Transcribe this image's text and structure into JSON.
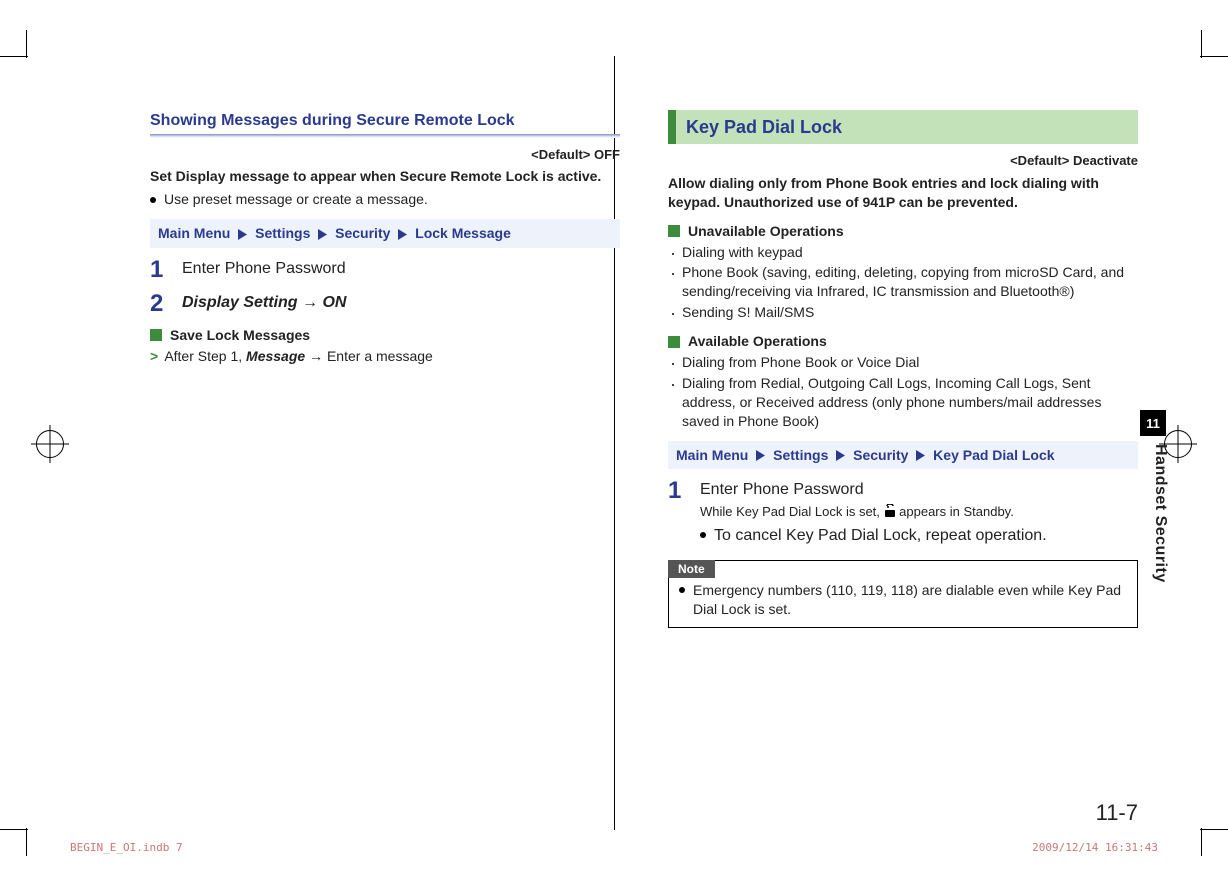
{
  "left": {
    "heading": "Showing Messages during Secure Remote Lock",
    "default": "<Default> OFF",
    "intro": "Set Display message to appear when Secure Remote Lock is active.",
    "intro_bullet": "Use preset message or create a message.",
    "crumb": [
      "Main Menu",
      "Settings",
      "Security",
      "Lock Message"
    ],
    "step1": "Enter Phone Password",
    "step2_a": "Display Setting",
    "step2_b": "ON",
    "sub_header": "Save Lock Messages",
    "sub_line_pre": "After Step 1,",
    "sub_line_mid": "Message",
    "sub_line_post": "Enter a message"
  },
  "right": {
    "banner": "Key Pad Dial Lock",
    "default": "<Default> Deactivate",
    "intro": "Allow dialing only from Phone Book entries and lock dialing with keypad. Unauthorized use of 941P can be prevented.",
    "una_header": "Unavailable Operations",
    "una_items": [
      "Dialing with keypad",
      "Phone Book (saving, editing, deleting, copying from microSD Card, and sending/receiving via Infrared, IC transmission and Bluetooth®)",
      "Sending S! Mail/SMS"
    ],
    "ava_header": "Available Operations",
    "ava_items": [
      "Dialing from Phone Book or Voice Dial",
      "Dialing from Redial, Outgoing Call Logs, Incoming Call Logs, Sent address, or Received address (only phone numbers/mail addresses saved in Phone Book)"
    ],
    "crumb": [
      "Main Menu",
      "Settings",
      "Security",
      "Key Pad Dial Lock"
    ],
    "step1": "Enter Phone Password",
    "step1_sub_pre": "While Key Pad Dial Lock is set,",
    "step1_sub_post": "appears in Standby.",
    "step1_bullet": "To cancel Key Pad Dial Lock, repeat operation.",
    "note_tag": "Note",
    "note_item": "Emergency numbers (110, 119, 118) are dialable even while Key Pad Dial Lock is set."
  },
  "tab": "11",
  "vlabel": "Handset Security",
  "page_num": "11-7",
  "footer_left": "BEGIN_E_OI.indb   7",
  "footer_right": "2009/12/14   16:31:43"
}
